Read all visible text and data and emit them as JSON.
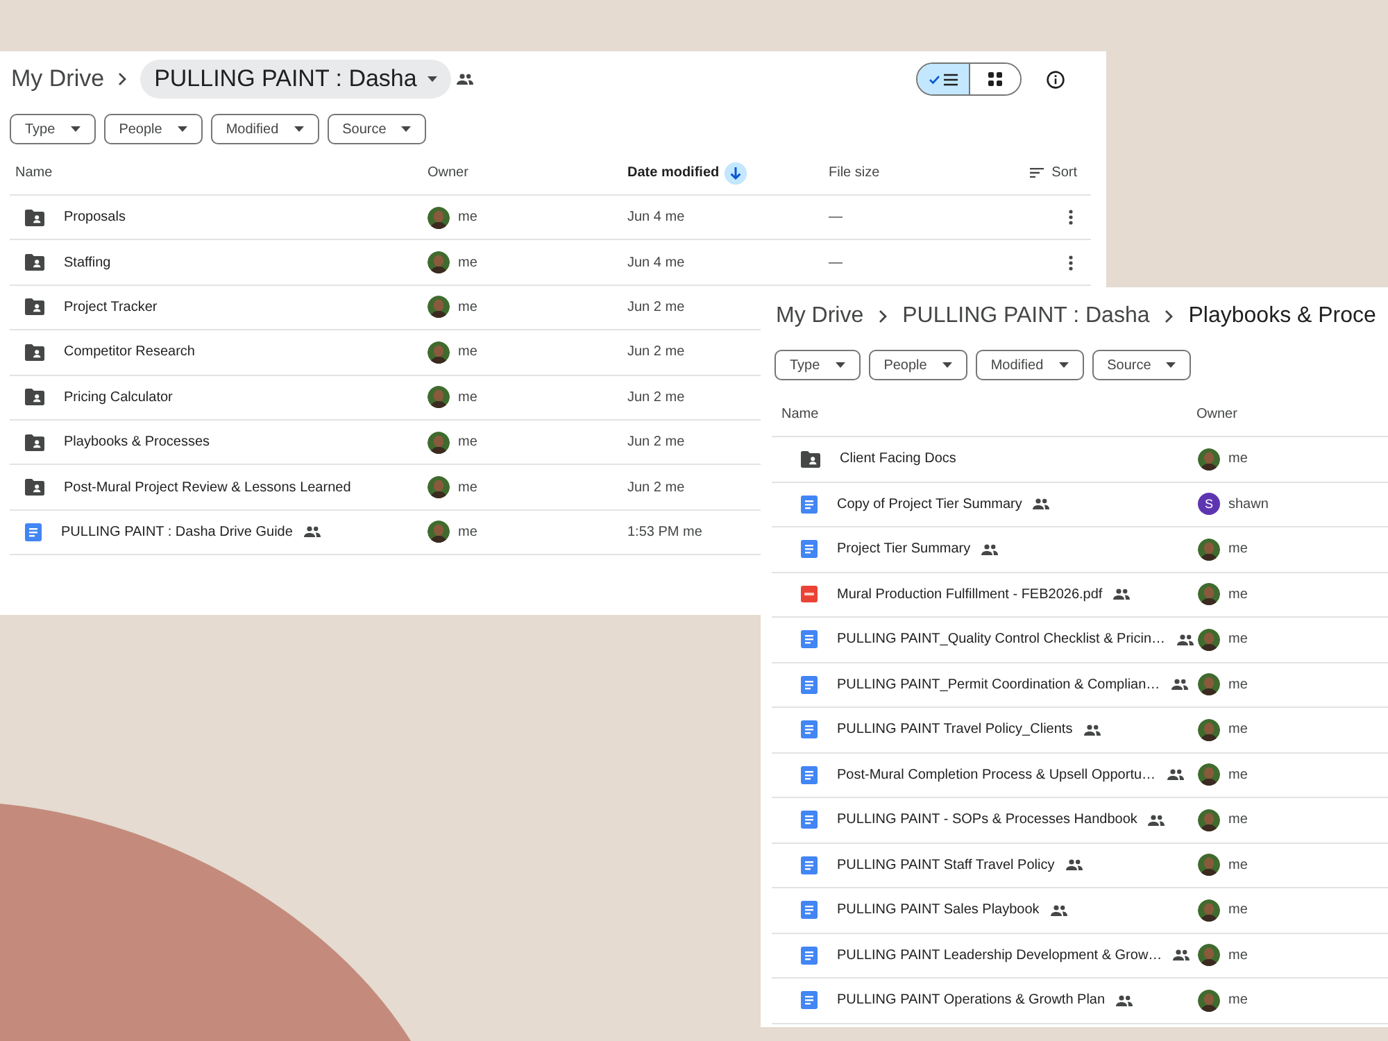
{
  "drive_window": {
    "breadcrumb": [
      {
        "label": "My Drive",
        "kind": "link"
      },
      {
        "label": "PULLING PAINT : Dasha",
        "kind": "chip",
        "shared": true
      }
    ],
    "view_toggle": [
      {
        "kind": "list",
        "selected": true
      },
      {
        "kind": "grid",
        "selected": false
      }
    ],
    "filters": [
      "Type",
      "People",
      "Modified",
      "Source"
    ],
    "columns": [
      {
        "label": "Name",
        "sorted": false
      },
      {
        "label": "Owner",
        "sorted": false
      },
      {
        "label": "Date modified",
        "sorted": true
      },
      {
        "label": "File size",
        "sorted": false
      }
    ],
    "sort_button": "Sort",
    "rows": [
      {
        "kind": "folder",
        "name": "Proposals",
        "shared": false,
        "owner": "me",
        "modified": "Jun 4 me",
        "size": "—",
        "menu": true
      },
      {
        "kind": "folder",
        "name": "Staffing",
        "shared": false,
        "owner": "me",
        "modified": "Jun 4 me",
        "size": "—",
        "menu": true
      },
      {
        "kind": "folder",
        "name": "Project Tracker",
        "shared": false,
        "owner": "me",
        "modified": "Jun 2 me",
        "menu": false
      },
      {
        "kind": "folder",
        "name": "Competitor Research",
        "shared": false,
        "owner": "me",
        "modified": "Jun 2 me",
        "menu": false
      },
      {
        "kind": "folder",
        "name": "Pricing Calculator",
        "shared": false,
        "owner": "me",
        "modified": "Jun 2 me",
        "menu": false
      },
      {
        "kind": "folder",
        "name": "Playbooks & Processes",
        "shared": false,
        "owner": "me",
        "modified": "Jun 2 me",
        "menu": false
      },
      {
        "kind": "folder",
        "name": "Post-Mural Project Review & Lessons Learned",
        "shared": false,
        "owner": "me",
        "modified": "Jun 2 me",
        "menu": false
      },
      {
        "kind": "doc",
        "name": "PULLING PAINT : Dasha Drive Guide",
        "shared": true,
        "owner": "me",
        "modified": "1:53 PM me",
        "menu": false
      }
    ]
  },
  "subfolder_window": {
    "breadcrumb": [
      {
        "label": "My Drive",
        "kind": "link"
      },
      {
        "label": "PULLING PAINT : Dasha",
        "kind": "link"
      },
      {
        "label": "Playbooks & Proce",
        "kind": "current"
      }
    ],
    "filters": [
      "Type",
      "People",
      "Modified",
      "Source"
    ],
    "columns": [
      {
        "label": "Name",
        "sorted": false
      },
      {
        "label": "Owner",
        "sorted": false
      }
    ],
    "rows": [
      {
        "kind": "folder",
        "name": "Client Facing Docs",
        "shared": false,
        "owner": "me"
      },
      {
        "kind": "doc",
        "name": "Copy of Project Tier Summary",
        "shared": true,
        "owner": "shawn",
        "initial": "S"
      },
      {
        "kind": "doc",
        "name": "Project Tier Summary",
        "shared": true,
        "owner": "me"
      },
      {
        "kind": "pdf",
        "name": "Mural Production Fulfillment - FEB2026.pdf",
        "shared": true,
        "owner": "me"
      },
      {
        "kind": "doc",
        "name": "PULLING PAINT_Quality Control Checklist & Pricin…",
        "shared": true,
        "owner": "me"
      },
      {
        "kind": "doc",
        "name": "PULLING PAINT_Permit Coordination & Complian…",
        "shared": true,
        "owner": "me"
      },
      {
        "kind": "doc",
        "name": "PULLING PAINT Travel Policy_Clients",
        "shared": true,
        "owner": "me"
      },
      {
        "kind": "doc",
        "name": "Post-Mural Completion Process & Upsell Opportu…",
        "shared": true,
        "owner": "me"
      },
      {
        "kind": "doc",
        "name": "PULLING PAINT - SOPs & Processes Handbook",
        "shared": true,
        "owner": "me"
      },
      {
        "kind": "doc",
        "name": "PULLING PAINT Staff Travel Policy",
        "shared": true,
        "owner": "me"
      },
      {
        "kind": "doc",
        "name": "PULLING PAINT Sales Playbook",
        "shared": true,
        "owner": "me"
      },
      {
        "kind": "doc",
        "name": "PULLING PAINT Leadership Development & Grow…",
        "shared": true,
        "owner": "me"
      },
      {
        "kind": "doc",
        "name": "PULLING PAINT Operations & Growth Plan",
        "shared": true,
        "owner": "me"
      }
    ]
  }
}
